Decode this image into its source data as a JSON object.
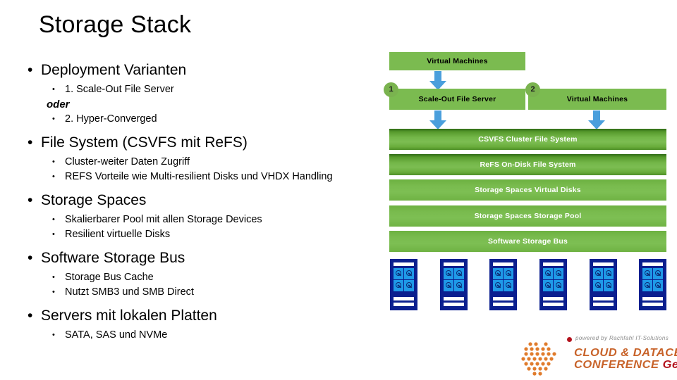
{
  "slide": {
    "title": "Storage Stack"
  },
  "bullets": [
    {
      "level": 1,
      "text": "Deployment Varianten",
      "children": [
        {
          "level": 2,
          "text": "1. Scale-Out File Server"
        },
        {
          "level": 2,
          "style": "bold-italic",
          "text": "oder"
        },
        {
          "level": 2,
          "text": "2. Hyper-Converged"
        }
      ]
    },
    {
      "level": 1,
      "text": "File System (CSVFS mit ReFS)",
      "children": [
        {
          "level": 2,
          "text": "Cluster-weiter Daten Zugriff"
        },
        {
          "level": 2,
          "text": "REFS Vorteile wie Multi-resilient Disks und VHDX Handling"
        }
      ]
    },
    {
      "level": 1,
      "text": "Storage Spaces",
      "children": [
        {
          "level": 2,
          "text": "Skalierbarer Pool mit allen Storage Devices"
        },
        {
          "level": 2,
          "text": "Resilient virtuelle Disks"
        }
      ]
    },
    {
      "level": 1,
      "text": "Software Storage Bus",
      "children": [
        {
          "level": 2,
          "text": "Storage Bus Cache"
        },
        {
          "level": 2,
          "text": "Nutzt SMB3 und SMB Direct"
        }
      ]
    },
    {
      "level": 1,
      "text": "Servers mit lokalen Platten",
      "children": [
        {
          "level": 2,
          "text": "SATA, SAS und NVMe"
        }
      ]
    }
  ],
  "diagram": {
    "top_box": {
      "label": "Virtual Machines"
    },
    "variant_1": {
      "badge": "1",
      "label": "Scale-Out File Server"
    },
    "variant_2": {
      "badge": "2",
      "label": "Virtual Machines"
    },
    "stack": [
      {
        "label": "CSVFS Cluster File System"
      },
      {
        "label": "ReFS On-Disk File System"
      },
      {
        "label": "Storage Spaces Virtual Disks"
      },
      {
        "label": "Storage Spaces Storage Pool"
      },
      {
        "label": "Software Storage Bus"
      }
    ],
    "server_count": 6,
    "colors": {
      "box_green": "#7bbb50",
      "band_green_dark": "#2d6a14",
      "badge_green": "#7ab34f",
      "arrow_blue": "#4a9fdc",
      "server_navy": "#0b1f8f",
      "disk_blue": "#1f9ae8"
    }
  },
  "logo": {
    "powered_by": "powered by Rachfahl IT-Solutions",
    "line1": "CLOUD & DATACENTER",
    "line2": "CONFERENCE ",
    "line2_accent": "Germany",
    "colors": {
      "orange": "#c8632a",
      "red": "#b3121d",
      "dot_orange": "#e07b2c"
    }
  }
}
